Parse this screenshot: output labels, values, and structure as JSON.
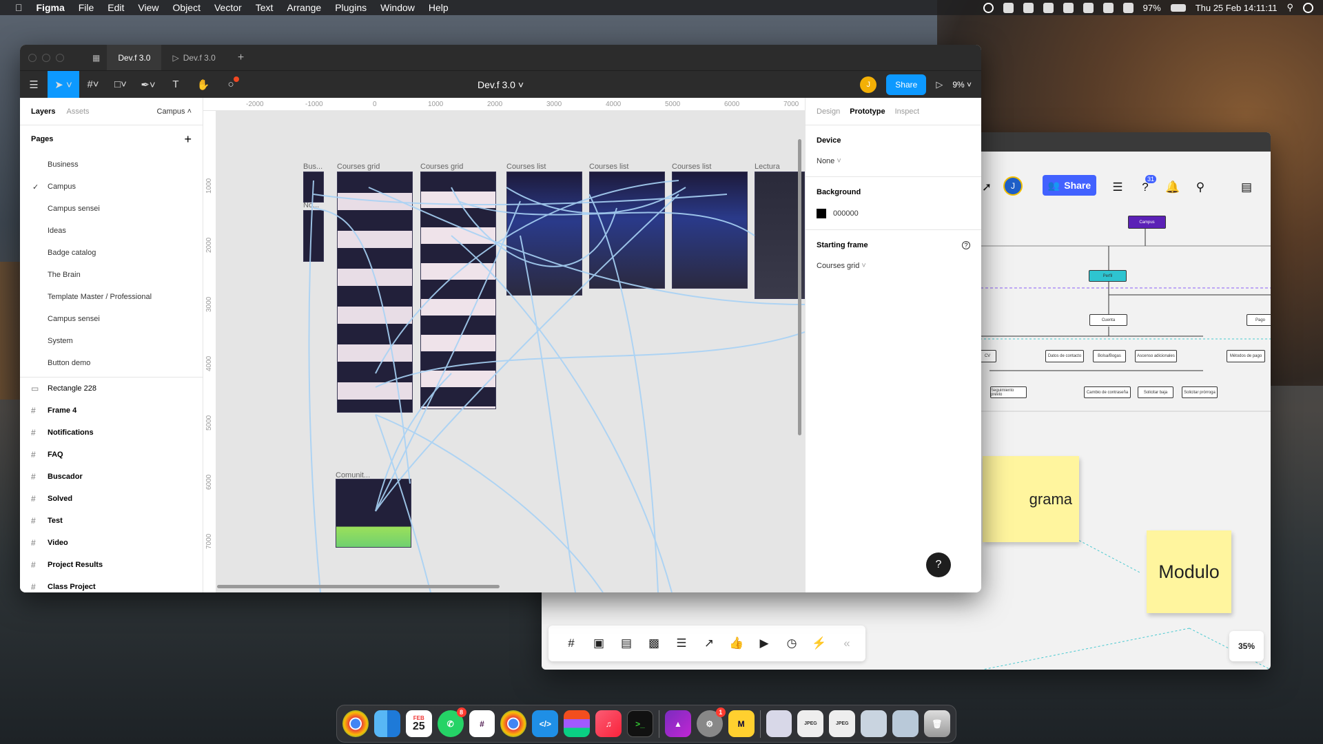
{
  "menubar": {
    "app": "Figma",
    "items": [
      "File",
      "Edit",
      "View",
      "Object",
      "Vector",
      "Text",
      "Arrange",
      "Plugins",
      "Window",
      "Help"
    ],
    "battery": "97%",
    "datetime": "Thu 25 Feb  14:11:11"
  },
  "figma": {
    "tabs": [
      "Dev.f 3.0",
      "Dev.f 3.0"
    ],
    "doc_title": "Dev.f 3.0",
    "avatar_initial": "J",
    "share_label": "Share",
    "zoom": "9%",
    "left_tabs": {
      "layers": "Layers",
      "assets": "Assets",
      "page": "Campus"
    },
    "pages_header": "Pages",
    "pages": [
      "Business",
      "Campus",
      "Campus sensei",
      "Ideas",
      "Badge catalog",
      "The Brain",
      "Template Master / Professional",
      "Campus sensei",
      "System",
      "Button demo"
    ],
    "layers": [
      {
        "name": "Rectangle 228",
        "icon": "rectangle-icon"
      },
      {
        "name": "Frame 4",
        "icon": "frame-icon"
      },
      {
        "name": "Notifications",
        "icon": "frame-icon"
      },
      {
        "name": "FAQ",
        "icon": "frame-icon"
      },
      {
        "name": "Buscador",
        "icon": "frame-icon"
      },
      {
        "name": "Solved",
        "icon": "frame-icon"
      },
      {
        "name": "Test",
        "icon": "frame-icon"
      },
      {
        "name": "Video",
        "icon": "frame-icon"
      },
      {
        "name": "Project Results",
        "icon": "frame-icon"
      },
      {
        "name": "Class Project",
        "icon": "frame-icon"
      }
    ],
    "ruler_x": [
      "-2000",
      "-1000",
      "0",
      "1000",
      "2000",
      "3000",
      "4000",
      "5000",
      "6000",
      "7000"
    ],
    "ruler_y": [
      "1000",
      "2000",
      "3000",
      "4000",
      "5000",
      "6000",
      "7000"
    ],
    "frames": [
      "Bus...",
      "No...",
      "Courses grid",
      "Courses grid",
      "Courses list",
      "Courses list",
      "Courses list",
      "Lectura",
      "Comunit..."
    ],
    "right_tabs": {
      "design": "Design",
      "prototype": "Prototype",
      "inspect": "Inspect"
    },
    "device_header": "Device",
    "device_value": "None",
    "background_header": "Background",
    "background_value": "000000",
    "starting_frame_header": "Starting frame",
    "starting_frame_value": "Courses grid",
    "help": "?"
  },
  "miro": {
    "share_label": "Share",
    "avatar_initial": "J",
    "notif_count": "31",
    "nodes": [
      "Campus",
      "Perfil",
      "Cuenta",
      "Pago",
      "CV",
      "Datos de contacto",
      "Bolsa/Bogas",
      "Ascenso adicionales",
      "Métodos de pago",
      "Seguimiento previo",
      "Cambio de contraseña",
      "Solicitar baja",
      "Solicitar prórroga"
    ],
    "sticky1": "grama",
    "sticky2": "Modulo",
    "zoom": "35%"
  },
  "dock": {
    "calendar_month": "FEB",
    "calendar_day": "25",
    "whatsapp_badge": "8",
    "settings_badge": "1"
  },
  "colors": {
    "accent": "#0d99ff",
    "miro_blue": "#4262ff",
    "campus_node": "#5b21b6",
    "perfil_node": "#2ec4d0",
    "sticky": "#fff59e"
  }
}
